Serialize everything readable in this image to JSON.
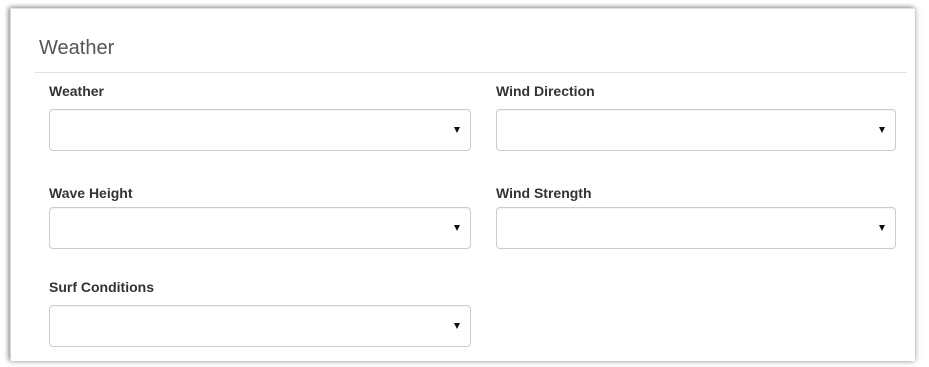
{
  "section": {
    "title": "Weather"
  },
  "fields": {
    "weather": {
      "label": "Weather",
      "value": ""
    },
    "wind_direction": {
      "label": "Wind Direction",
      "value": ""
    },
    "wave_height": {
      "label": "Wave Height",
      "value": ""
    },
    "wind_strength": {
      "label": "Wind Strength",
      "value": ""
    },
    "surf_conditions": {
      "label": "Surf Conditions",
      "value": ""
    }
  },
  "icons": {
    "dropdown": "caret-down-icon"
  }
}
